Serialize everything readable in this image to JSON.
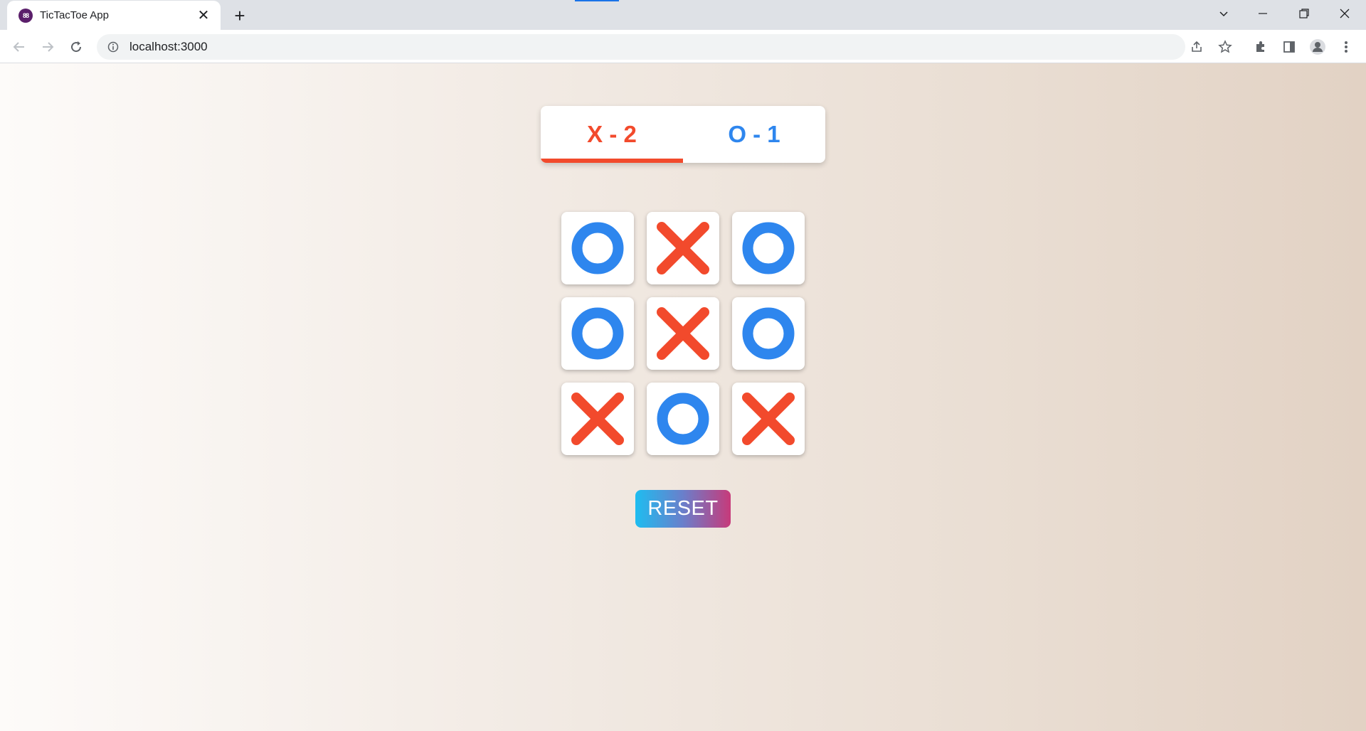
{
  "browser": {
    "tab_title": "TicTacToe App",
    "favicon_glyph": "88",
    "new_tab_label": "+",
    "close_tab_label": "✕",
    "url": "localhost:3000"
  },
  "colors": {
    "x": "#f24a2c",
    "o": "#2e86ee",
    "reset_gradient": [
      "#1ebdf0",
      "#c73a7a"
    ]
  },
  "score": {
    "x_label": "X - 2",
    "o_label": "O - 1",
    "active_player": "X"
  },
  "board": {
    "cells": [
      "O",
      "X",
      "O",
      "O",
      "X",
      "O",
      "X",
      "O",
      "X"
    ]
  },
  "reset_label": "RESET"
}
